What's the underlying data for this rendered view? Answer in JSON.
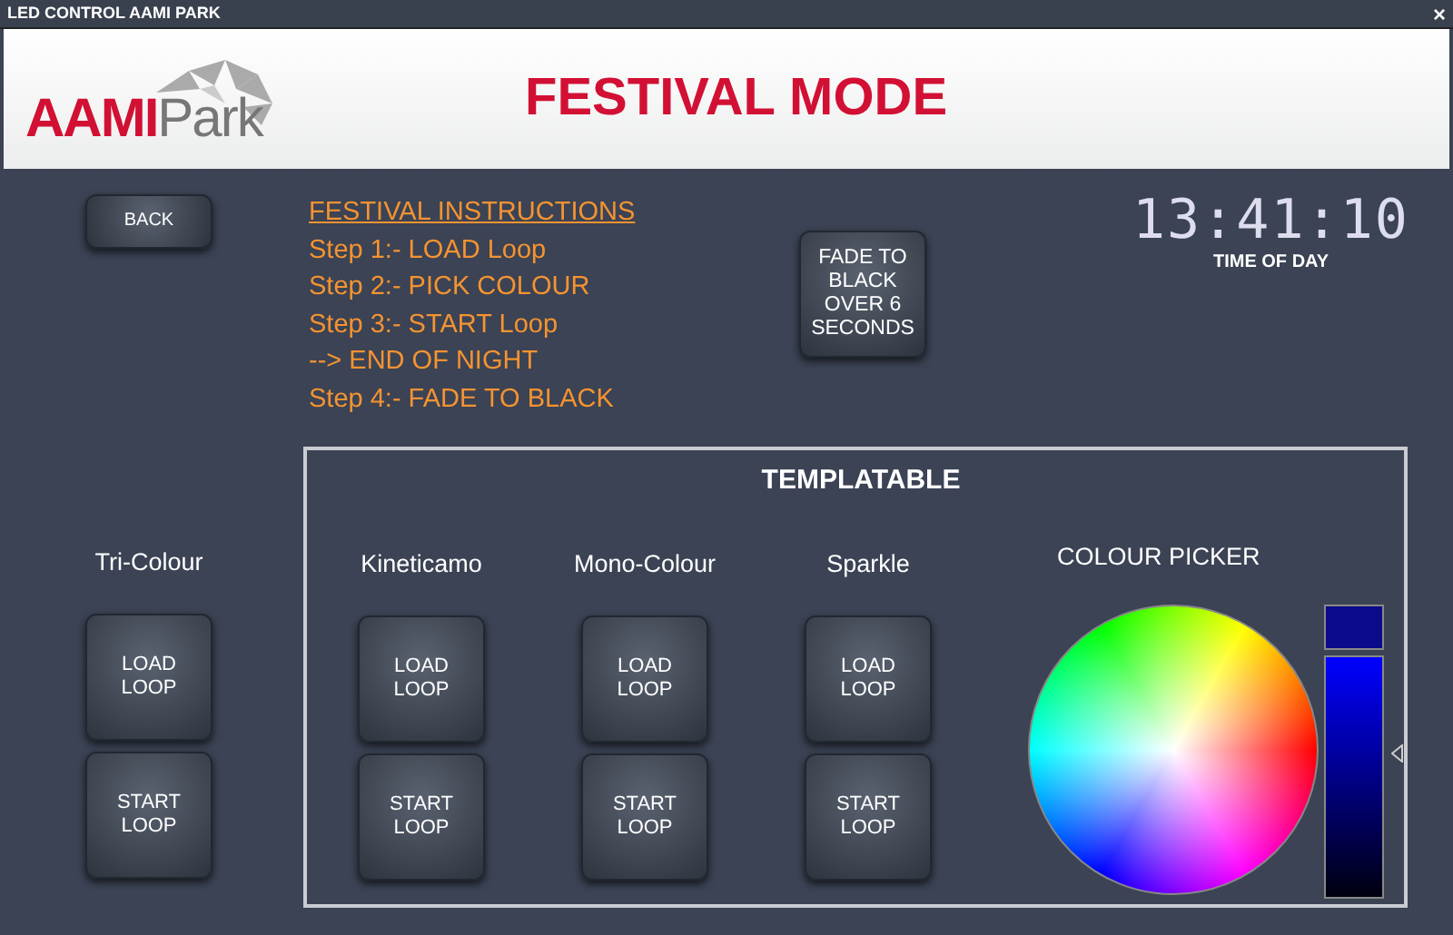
{
  "window": {
    "title": "LED CONTROL AAMI PARK",
    "close": "×"
  },
  "header": {
    "logo_main": "AAMI",
    "logo_sub": "Park",
    "title": "FESTIVAL MODE"
  },
  "back_button": "BACK",
  "instructions": {
    "heading": "FESTIVAL INSTRUCTIONS",
    "steps": [
      "Step 1:- LOAD Loop",
      "Step 2:- PICK COLOUR",
      "Step 3:- START Loop",
      "--> END OF NIGHT",
      "Step 4:- FADE TO BLACK"
    ]
  },
  "fade_button": "FADE TO BLACK OVER 6 SECONDS",
  "clock": {
    "time": "13:41:10",
    "label": "TIME OF DAY"
  },
  "standalone_group": {
    "title": "Tri-Colour",
    "buttons": [
      "LOAD LOOP",
      "START LOOP"
    ]
  },
  "templatable": {
    "title": "TEMPLATABLE",
    "groups": [
      {
        "title": "Kineticamo",
        "buttons": [
          "LOAD LOOP",
          "START LOOP"
        ]
      },
      {
        "title": "Mono-Colour",
        "buttons": [
          "LOAD LOOP",
          "START LOOP"
        ]
      },
      {
        "title": "Sparkle",
        "buttons": [
          "LOAD LOOP",
          "START LOOP"
        ]
      }
    ],
    "colour_picker": {
      "title": "COLOUR PICKER",
      "brightness": {
        "level": 0.6
      }
    }
  }
}
